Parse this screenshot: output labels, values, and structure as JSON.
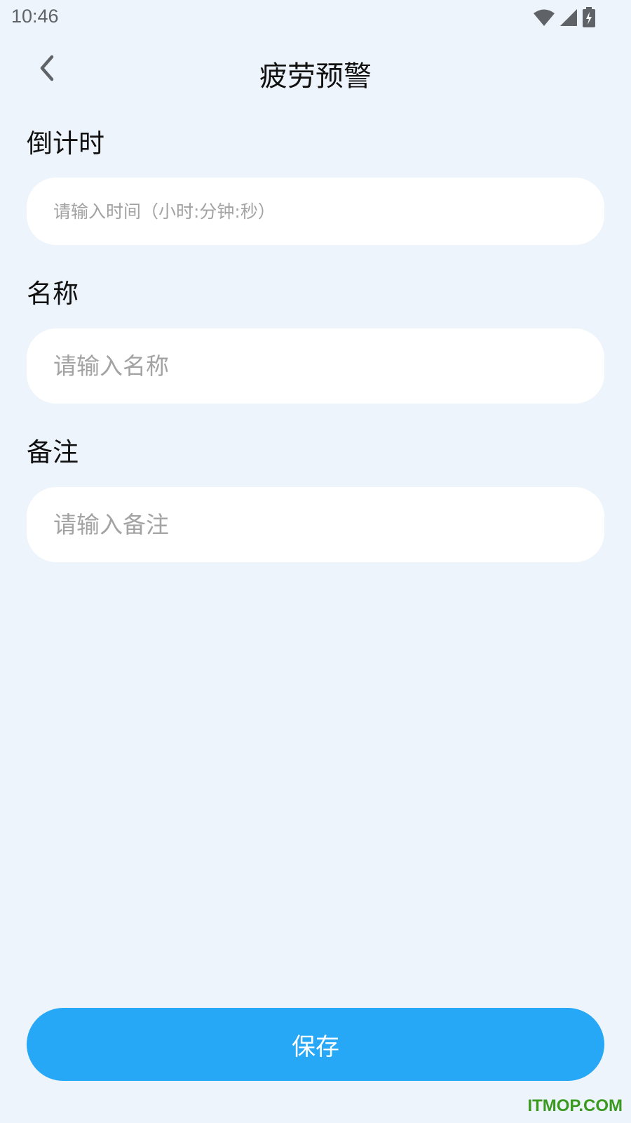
{
  "status_bar": {
    "time": "10:46",
    "icons": [
      "wifi-icon",
      "signal-icon",
      "battery-charging-icon"
    ]
  },
  "header": {
    "title": "疲劳预警",
    "back_icon": "chevron-left-icon"
  },
  "form": {
    "countdown": {
      "label": "倒计时",
      "placeholder": "请输入时间（小时:分钟:秒）",
      "value": ""
    },
    "name": {
      "label": "名称",
      "placeholder": "请输入名称",
      "value": ""
    },
    "remark": {
      "label": "备注",
      "placeholder": "请输入备注",
      "value": ""
    }
  },
  "save_button": {
    "label": "保存"
  },
  "watermark": "ITMOP.COM",
  "colors": {
    "background": "#eef4fb",
    "accent": "#26a8f6",
    "watermark": "#3a9a20"
  }
}
